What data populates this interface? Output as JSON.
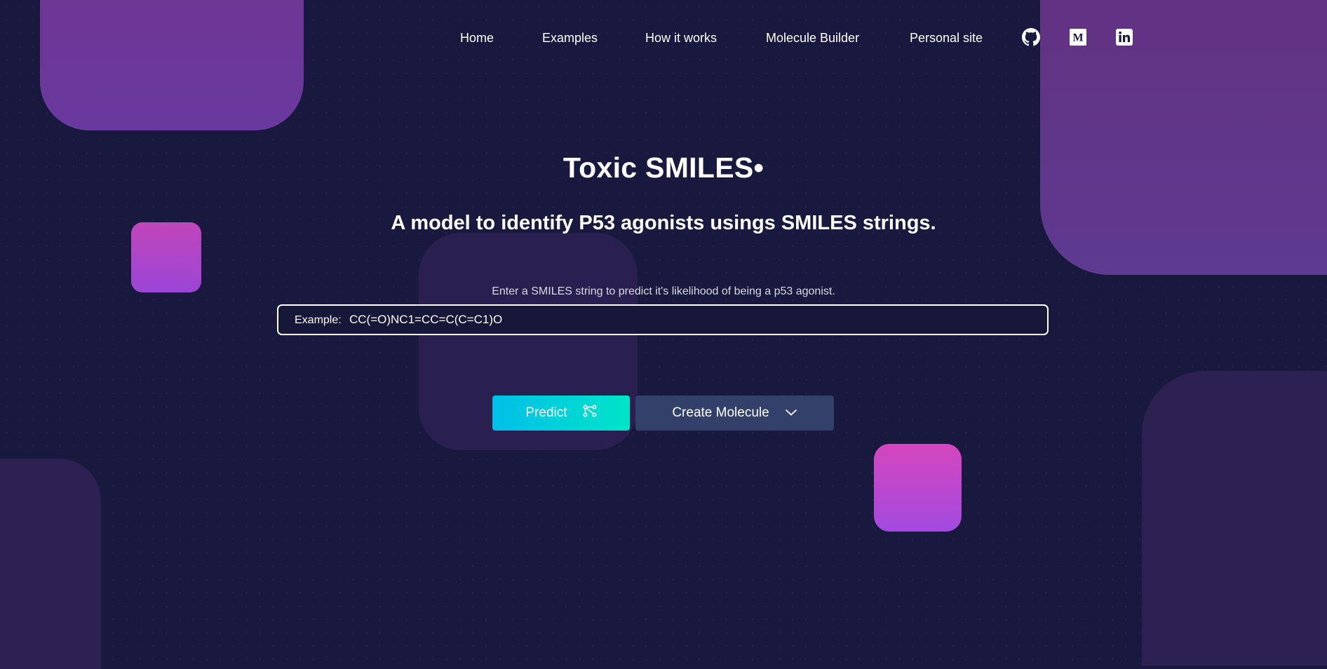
{
  "nav": {
    "links": [
      "Home",
      "Examples",
      "How it works",
      "Molecule Builder",
      "Personal site"
    ],
    "icons": [
      "github-icon",
      "medium-icon",
      "linkedin-icon"
    ]
  },
  "hero": {
    "title": "Toxic SMILES•",
    "subtitle": "A model to identify P53 agonists usings SMILES strings."
  },
  "form": {
    "prompt": "Enter a SMILES string to predict it's likelihood of being a p53 agonist.",
    "input_label": "Example:",
    "input_placeholder": "CC(=O)NC1=CC=C(C=C1)O"
  },
  "buttons": {
    "predict_label": "Predict",
    "create_label": "Create Molecule"
  },
  "colors": {
    "background": "#19193f",
    "predict_gradient_start": "#00bfe8",
    "predict_gradient_end": "#00e4c8",
    "create_button": "#33416a",
    "accent_purple": "#a24ae0"
  }
}
